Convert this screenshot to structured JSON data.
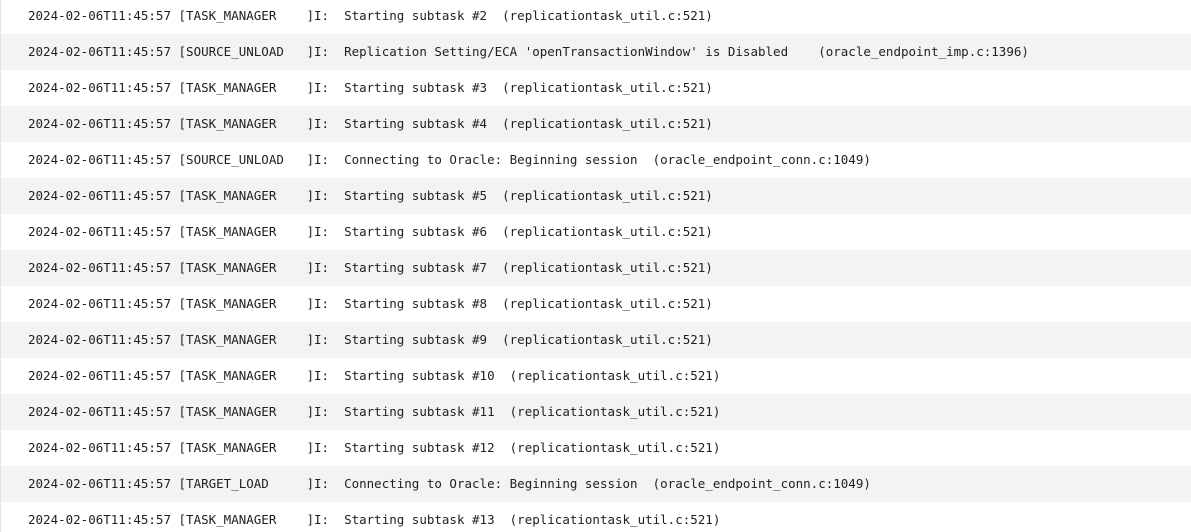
{
  "log": {
    "lines": [
      "2024-02-06T11:45:57 [TASK_MANAGER    ]I:  Starting subtask #2  (replicationtask_util.c:521)",
      "2024-02-06T11:45:57 [SOURCE_UNLOAD   ]I:  Replication Setting/ECA 'openTransactionWindow' is Disabled    (oracle_endpoint_imp.c:1396)",
      "2024-02-06T11:45:57 [TASK_MANAGER    ]I:  Starting subtask #3  (replicationtask_util.c:521)",
      "2024-02-06T11:45:57 [TASK_MANAGER    ]I:  Starting subtask #4  (replicationtask_util.c:521)",
      "2024-02-06T11:45:57 [SOURCE_UNLOAD   ]I:  Connecting to Oracle: Beginning session  (oracle_endpoint_conn.c:1049)",
      "2024-02-06T11:45:57 [TASK_MANAGER    ]I:  Starting subtask #5  (replicationtask_util.c:521)",
      "2024-02-06T11:45:57 [TASK_MANAGER    ]I:  Starting subtask #6  (replicationtask_util.c:521)",
      "2024-02-06T11:45:57 [TASK_MANAGER    ]I:  Starting subtask #7  (replicationtask_util.c:521)",
      "2024-02-06T11:45:57 [TASK_MANAGER    ]I:  Starting subtask #8  (replicationtask_util.c:521)",
      "2024-02-06T11:45:57 [TASK_MANAGER    ]I:  Starting subtask #9  (replicationtask_util.c:521)",
      "2024-02-06T11:45:57 [TASK_MANAGER    ]I:  Starting subtask #10  (replicationtask_util.c:521)",
      "2024-02-06T11:45:57 [TASK_MANAGER    ]I:  Starting subtask #11  (replicationtask_util.c:521)",
      "2024-02-06T11:45:57 [TASK_MANAGER    ]I:  Starting subtask #12  (replicationtask_util.c:521)",
      "2024-02-06T11:45:57 [TARGET_LOAD     ]I:  Connecting to Oracle: Beginning session  (oracle_endpoint_conn.c:1049)",
      "2024-02-06T11:45:57 [TASK_MANAGER    ]I:  Starting subtask #13  (replicationtask_util.c:521)"
    ]
  }
}
